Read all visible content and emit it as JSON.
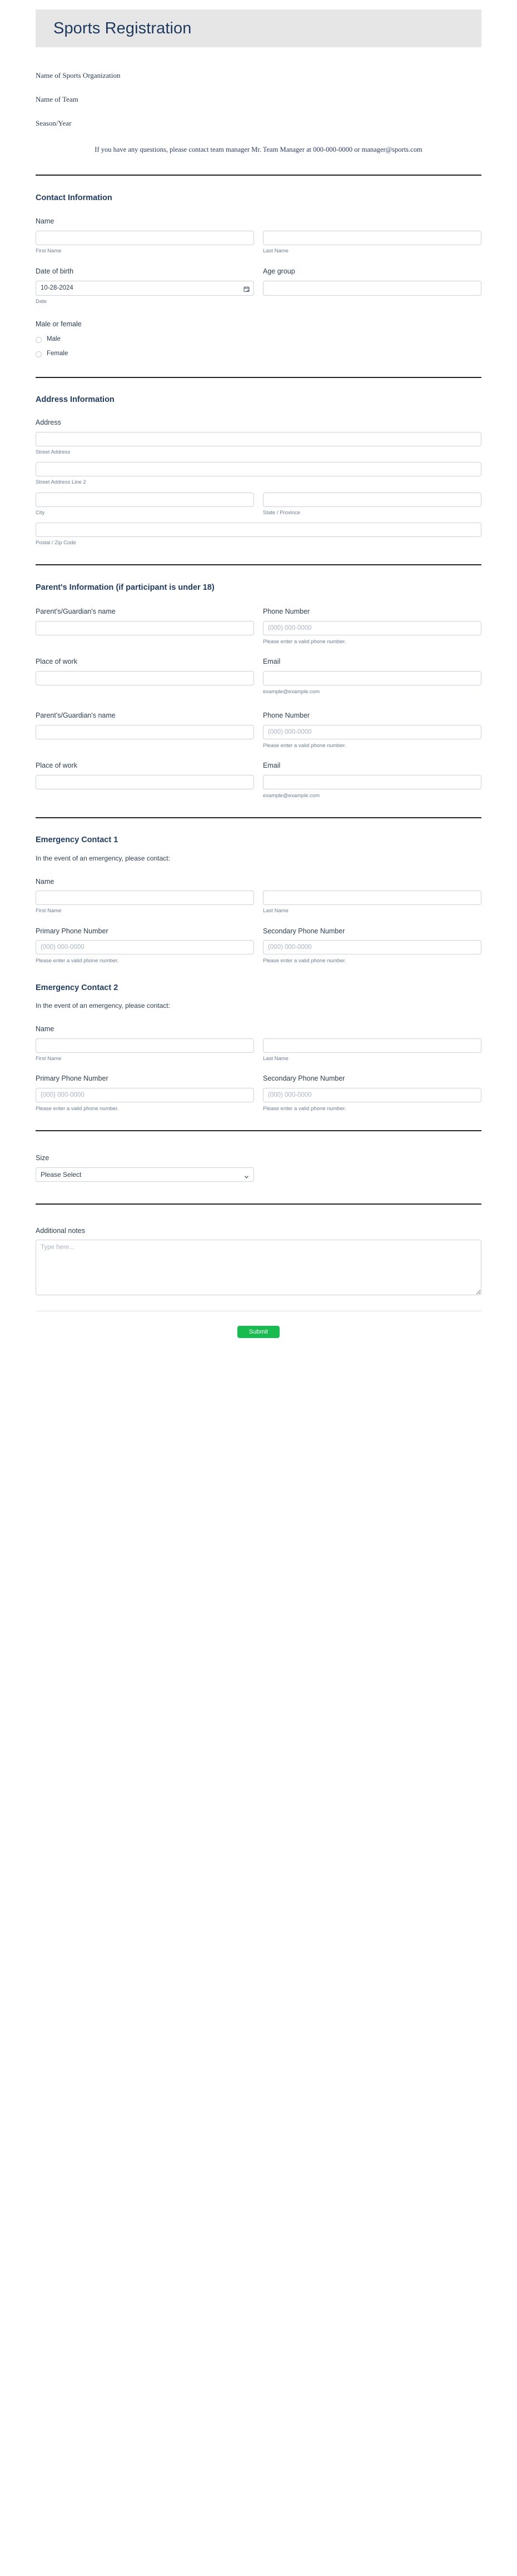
{
  "header": {
    "title": "Sports Registration"
  },
  "intro": {
    "lines": [
      "Name of Sports Organization",
      "Name of Team",
      "Season/Year"
    ],
    "notice": "If you have any questions, please contact team manager Mr. Team Manager at 000-000-0000 or manager@sports.com"
  },
  "contact_information": {
    "heading": "Contact Information",
    "name_label": "Name",
    "first_name_sub": "First Name",
    "last_name_sub": "Last Name",
    "dob_label": "Date of birth",
    "dob_value": "10-28-2024",
    "dob_sub": "Date",
    "age_group_label": "Age group",
    "gender_label": "Male or female",
    "gender_options": [
      "Male",
      "Female"
    ]
  },
  "address_information": {
    "heading": "Address Information",
    "address_label": "Address",
    "street_sub": "Street Address",
    "street2_sub": "Street Address Line 2",
    "city_sub": "City",
    "state_sub": "State / Province",
    "postal_sub": "Postal / Zip Code"
  },
  "parents_information": {
    "heading": "Parent's Information (if participant is under 18)",
    "entries": [
      {
        "name_label": "Parent's/Guardian's name",
        "phone_label": "Phone Number",
        "phone_placeholder": "(000) 000-0000",
        "phone_hint": "Please enter a valid phone number.",
        "work_label": "Place of work",
        "email_label": "Email",
        "email_hint": "example@example.com"
      },
      {
        "name_label": "Parent's/Guardian's name",
        "phone_label": "Phone Number",
        "phone_placeholder": "(000) 000-0000",
        "phone_hint": "Please enter a valid phone number.",
        "work_label": "Place of work",
        "email_label": "Email",
        "email_hint": "example@example.com"
      }
    ]
  },
  "emergency_contacts": [
    {
      "heading": "Emergency Contact 1",
      "intro": "In the event of an emergency, please contact:",
      "name_label": "Name",
      "first_name_sub": "First Name",
      "last_name_sub": "Last Name",
      "primary_phone_label": "Primary Phone Number",
      "secondary_phone_label": "Secondary Phone Number",
      "phone_placeholder": "(000) 000-0000",
      "phone_hint": "Please enter a valid phone number."
    },
    {
      "heading": "Emergency Contact 2",
      "intro": "In the event of an emergency, please contact:",
      "name_label": "Name",
      "first_name_sub": "First Name",
      "last_name_sub": "Last Name",
      "primary_phone_label": "Primary Phone Number",
      "secondary_phone_label": "Secondary Phone Number",
      "phone_placeholder": "(000) 000-0000",
      "phone_hint": "Please enter a valid phone number."
    }
  ],
  "size_section": {
    "label": "Size",
    "selected": "Please Select"
  },
  "notes_section": {
    "label": "Additional notes",
    "placeholder": "Type here..."
  },
  "footer": {
    "submit_label": "Submit"
  },
  "colors": {
    "header_bg": "#e6e6e6",
    "title": "#1f3a5f",
    "heading": "#1f3a5f",
    "submit_green": "#17bb4f",
    "border": "#ccd2dc",
    "divider": "#232323"
  }
}
